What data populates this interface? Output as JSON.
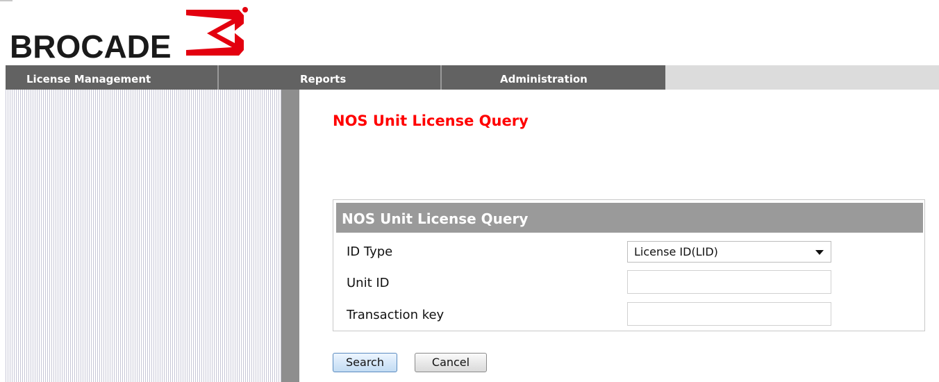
{
  "brand": {
    "name": "BROCADE",
    "accent_color": "#e3000f"
  },
  "nav": {
    "tabs": [
      {
        "label": "License Management"
      },
      {
        "label": "Reports"
      },
      {
        "label": "Administration"
      }
    ]
  },
  "main": {
    "title": "NOS Unit License Query",
    "title_color": "#ff0000",
    "panel": {
      "header": "NOS Unit License Query",
      "fields": {
        "id_type": {
          "label": "ID Type",
          "selected": "License ID(LID)"
        },
        "unit_id": {
          "label": "Unit ID",
          "value": ""
        },
        "transaction_key": {
          "label": "Transaction key",
          "value": ""
        }
      }
    },
    "buttons": {
      "search": "Search",
      "cancel": "Cancel"
    }
  }
}
